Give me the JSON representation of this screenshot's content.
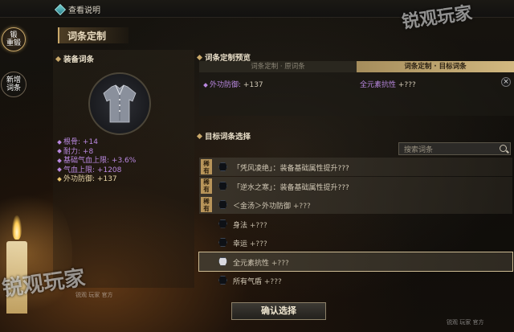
{
  "topbar": {
    "help_label": "查看说明"
  },
  "left_tabs": {
    "reforge": "重锻",
    "reforge_top": "锻",
    "new_affix": "新增词条"
  },
  "title": "词条定制",
  "equipment": {
    "header": "装备词条",
    "attributes": [
      {
        "name": "根骨",
        "value": "+14",
        "style": "purple"
      },
      {
        "name": "耐力",
        "value": "+8",
        "style": "purple"
      },
      {
        "name": "基础气血上限",
        "value": "+3.6%",
        "style": "purple"
      },
      {
        "name": "气血上限",
        "value": "+1208",
        "style": "purple"
      },
      {
        "name": "外功防御",
        "value": "+137",
        "style": "gold"
      }
    ]
  },
  "preview": {
    "header": "词条定制预览",
    "left_col": "词条定制 · 原词条",
    "right_col": "词条定制 · 目标词条",
    "original": {
      "name": "外功防御",
      "value": "+137"
    },
    "target": {
      "name": "全元素抗性",
      "value": "+???"
    },
    "close_symbol": "×"
  },
  "target_select": {
    "header": "目标词条选择",
    "search_placeholder": "搜索词条",
    "rows": [
      {
        "badge": "稀有",
        "text": "「凭风凌绝」：装备基础属性提升???",
        "value": "",
        "style": "rare",
        "selected": false
      },
      {
        "badge": "稀有",
        "text": "「逆水之寒」：装备基础属性提升???",
        "value": "",
        "style": "rare",
        "selected": false
      },
      {
        "badge": "稀有",
        "text": "＜金汤＞外功防御",
        "value": "+???",
        "style": "rare",
        "selected": false
      },
      {
        "badge": "",
        "text": "身法",
        "value": "+???",
        "style": "plain",
        "selected": false
      },
      {
        "badge": "",
        "text": "幸运",
        "value": "+???",
        "style": "plain",
        "selected": false
      },
      {
        "badge": "",
        "text": "全元素抗性",
        "value": "+???",
        "style": "selected",
        "selected": true
      },
      {
        "badge": "",
        "text": "所有气盾",
        "value": "+???",
        "style": "plain",
        "selected": false
      }
    ]
  },
  "confirm_label": "确认选择",
  "watermark": {
    "text": "锐观玩家",
    "sub": "锐观 玩家 官方"
  },
  "colors": {
    "accent_gold": "#c9a86a",
    "affix_purple": "#b988e0",
    "selected_outline": "#cdbb93"
  }
}
